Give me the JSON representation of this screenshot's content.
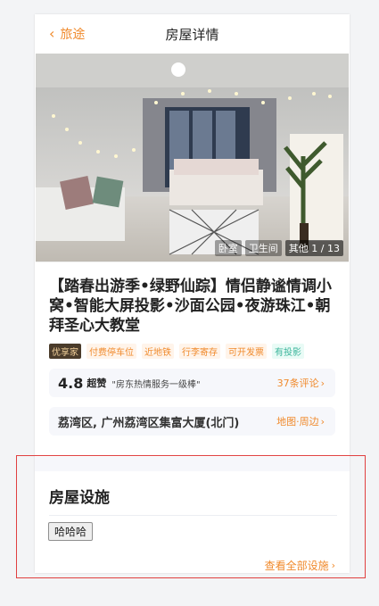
{
  "header": {
    "back_label": "旅途",
    "title": "房屋详情"
  },
  "gallery": {
    "tags": [
      "卧室",
      "卫生间",
      "其他"
    ],
    "counter": "1 / 13"
  },
  "listing": {
    "title": "【踏春出游季•绿野仙踪】情侣静谧情调小窝•智能大屏投影•沙面公园•夜游珠江•朝拜圣心大教堂",
    "badges": [
      {
        "label": "优享家",
        "style": "gold"
      },
      {
        "label": "付费停车位",
        "style": "orange"
      },
      {
        "label": "近地铁",
        "style": "orange"
      },
      {
        "label": "行李寄存",
        "style": "orange"
      },
      {
        "label": "可开发票",
        "style": "orange"
      },
      {
        "label": "有投影",
        "style": "green"
      }
    ]
  },
  "rating": {
    "score": "4.8",
    "level": "超赞",
    "quote": "\"房东热情服务一级棒\"",
    "reviews": "37条评论"
  },
  "address": {
    "text": "荔湾区, 广州荔湾区集富大厦(北门)",
    "map_link": "地图·周边"
  },
  "facilities": {
    "title": "房屋设施",
    "items": [
      "哈哈哈"
    ],
    "see_all": "查看全部设施"
  },
  "colors": {
    "accent": "#f08a2c",
    "highlight_border": "#e04040"
  }
}
